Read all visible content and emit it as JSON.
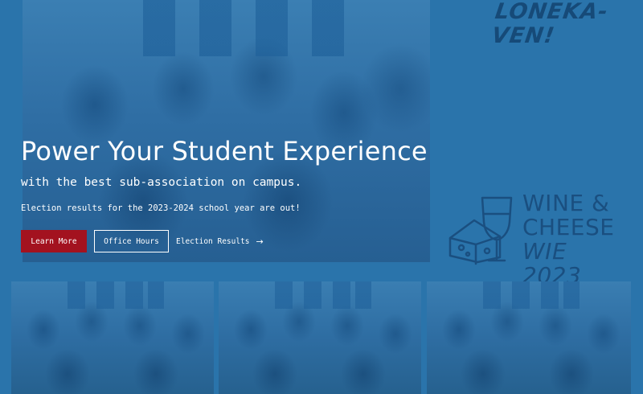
{
  "hero": {
    "title": "Power Your Student Experience",
    "subtitle": "with the best sub-association on campus.",
    "note": "Election results for the 2023-2024 school year are out!"
  },
  "buttons": {
    "learn_more": "Learn More",
    "office_hours": "Office Hours",
    "election_results": "Election Results",
    "election_arrow": "→"
  },
  "logos": {
    "brand": "LONEKA-VEN!",
    "wine_line1": "WINE &",
    "wine_line2": "CHEESE",
    "wine_line3": "WIE 2023"
  },
  "colors": {
    "background": "#2a74ab",
    "primary_button": "#a3121f",
    "text": "#ffffff"
  }
}
